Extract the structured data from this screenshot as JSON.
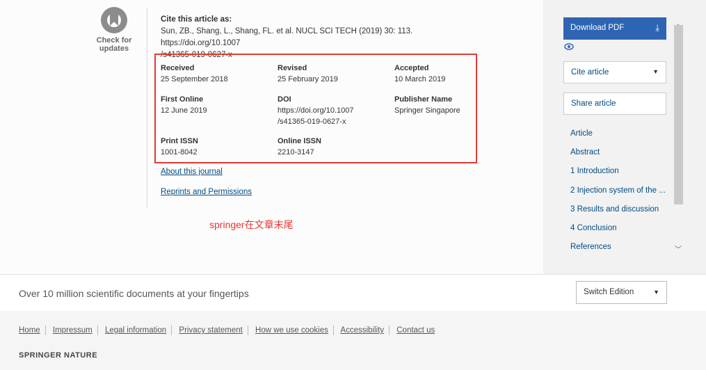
{
  "check_updates": {
    "line1": "Check for",
    "line2": "updates"
  },
  "cite": {
    "title": "Cite this article as:",
    "text": "Sun, ZB., Shang, L., Shang, FL. et al. NUCL SCI TECH (2019) 30: 113. https://doi.org/10.1007",
    "text2": "/s41365-019-0627-x"
  },
  "fields": {
    "received": {
      "label": "Received",
      "value": "25 September 2018"
    },
    "revised": {
      "label": "Revised",
      "value": "25 February 2019"
    },
    "accepted": {
      "label": "Accepted",
      "value": "10 March 2019"
    },
    "first_online": {
      "label": "First Online",
      "value": "12 June 2019"
    },
    "doi": {
      "label": "DOI",
      "value1": "https://doi.org/10.1007",
      "value2": "/s41365-019-0627-x"
    },
    "publisher": {
      "label": "Publisher Name",
      "value": "Springer Singapore"
    },
    "print_issn": {
      "label": "Print ISSN",
      "value": "1001-8042"
    },
    "online_issn": {
      "label": "Online ISSN",
      "value": "2210-3147"
    }
  },
  "links": {
    "about": "About this journal",
    "reprints": "Reprints and Permissions"
  },
  "annotation": "springer在文章末尾",
  "sidebar": {
    "download_pdf": "Download PDF",
    "cite_article": "Cite article",
    "share_article": "Share article",
    "toc": [
      "Article",
      "Abstract",
      "1 Introduction",
      "2 Injection system of the ...",
      "3 Results and discussion",
      "4 Conclusion",
      "References"
    ]
  },
  "band": {
    "text": "Over 10 million scientific documents at your fingertips",
    "switch_edition": "Switch Edition"
  },
  "footer": {
    "links": [
      "Home",
      "Impressum",
      "Legal information",
      "Privacy statement",
      "How we use cookies",
      "Accessibility",
      "Contact us"
    ],
    "brand": "SPRINGER NATURE"
  },
  "colors": {
    "accent": "#2e65b3",
    "link": "#004b83",
    "annotation": "#e53935"
  }
}
